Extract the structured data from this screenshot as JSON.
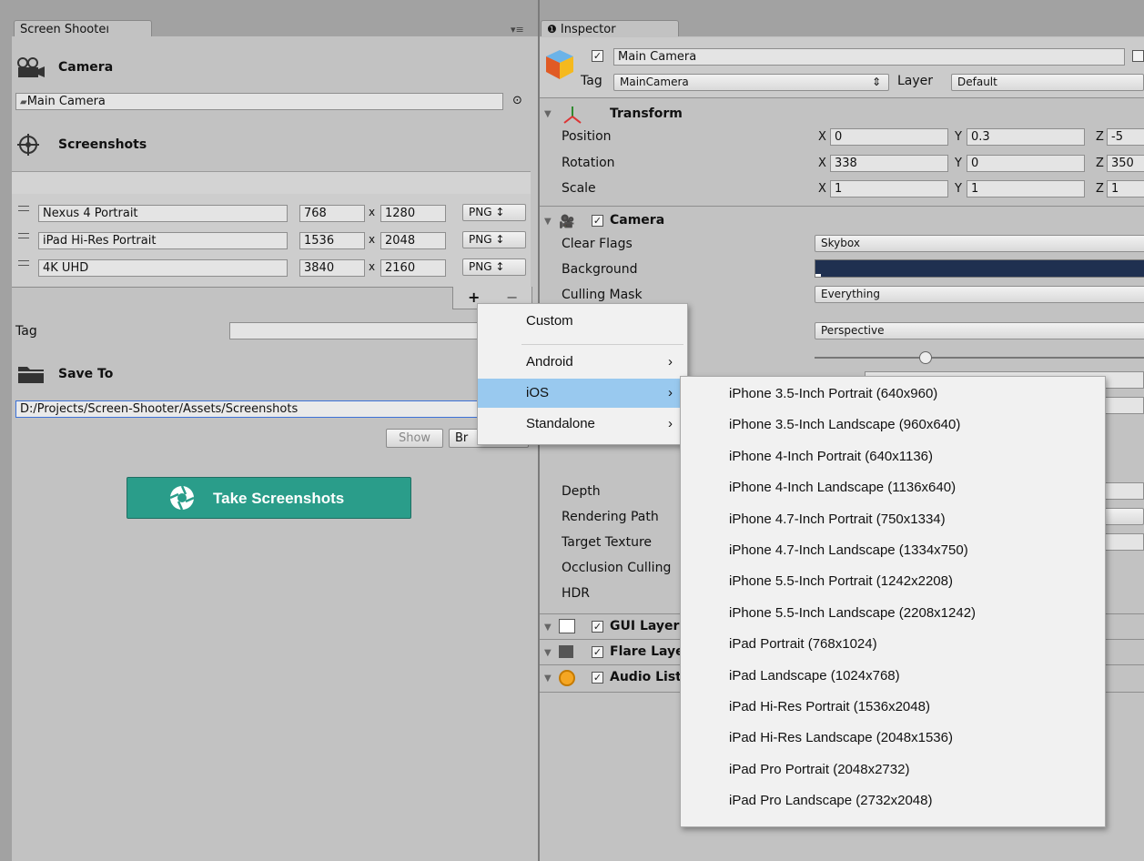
{
  "left_panel": {
    "tab_title": "Screen Shooteı",
    "camera_section": "Camera",
    "camera_field": "Main Camera",
    "screenshots_section": "Screenshots",
    "resolutions": [
      {
        "name": "Nexus 4 Portrait",
        "width": "768",
        "height": "1280",
        "format": "PNG ↕"
      },
      {
        "name": "iPad Hi-Res Portrait",
        "width": "1536",
        "height": "2048",
        "format": "PNG ↕"
      },
      {
        "name": "4K UHD",
        "width": "3840",
        "height": "2160",
        "format": "PNG ↕"
      }
    ],
    "x_label": "x",
    "plus": "+",
    "minus": "−",
    "tag_label": "Tag",
    "tag_value": "",
    "save_to_section": "Save To",
    "path_value": "D:/Projects/Screen-Shooter/Assets/Screenshots",
    "show_button": "Show",
    "browse_button": "Br",
    "take_button": "Take Screenshots",
    "take_button_color": "#2a9d8a"
  },
  "inspector": {
    "tab_title": "Inspector",
    "object_name": "Main Camera",
    "tag_label": "Tag",
    "tag_value": "MainCamera",
    "layer_label": "Layer",
    "layer_value": "Default",
    "transform": {
      "title": "Transform",
      "rows": [
        {
          "label": "Position",
          "x": "0",
          "y": "0.3",
          "z": "-5"
        },
        {
          "label": "Rotation",
          "x": "338",
          "y": "0",
          "z": "350"
        },
        {
          "label": "Scale",
          "x": "1",
          "y": "1",
          "z": "1"
        }
      ],
      "x_axis": "X",
      "y_axis": "Y",
      "z_axis": "Z"
    },
    "camera": {
      "title": "Camera",
      "clear_flags_label": "Clear Flags",
      "clear_flags_value": "Skybox",
      "background_label": "Background",
      "background_color": "#1f3050",
      "culling_mask_label": "Culling Mask",
      "culling_mask_value": "Everything",
      "projection_value": "Perspective",
      "depth_label": "Depth",
      "rendering_path_label": "Rendering Path",
      "target_texture_label": "Target Texture",
      "occlusion_label": "Occlusion Culling",
      "hdr_label": "HDR"
    },
    "components": [
      {
        "title": "GUI Layer"
      },
      {
        "title": "Flare Layer"
      },
      {
        "title": "Audio Listener"
      }
    ]
  },
  "menu": {
    "items": [
      {
        "label": "Custom",
        "arrow": ""
      },
      {
        "label": "Android",
        "arrow": "›"
      },
      {
        "label": "iOS",
        "arrow": "›"
      },
      {
        "label": "Standalone",
        "arrow": "›"
      }
    ],
    "highlight_color": "#99c9ef",
    "submenu": [
      "iPhone 3.5-Inch Portrait (640x960)",
      "iPhone 3.5-Inch Landscape (960x640)",
      "iPhone 4-Inch Portrait (640x1136)",
      "iPhone 4-Inch Landscape (1136x640)",
      "iPhone 4.7-Inch Portrait (750x1334)",
      "iPhone 4.7-Inch Landscape (1334x750)",
      "iPhone 5.5-Inch Portrait (1242x2208)",
      "iPhone 5.5-Inch Landscape (2208x1242)",
      "iPad Portrait (768x1024)",
      "iPad Landscape (1024x768)",
      "iPad Hi-Res Portrait (1536x2048)",
      "iPad Hi-Res Landscape (2048x1536)",
      "iPad Pro Portrait (2048x2732)",
      "iPad Pro Landscape (2732x2048)"
    ]
  }
}
